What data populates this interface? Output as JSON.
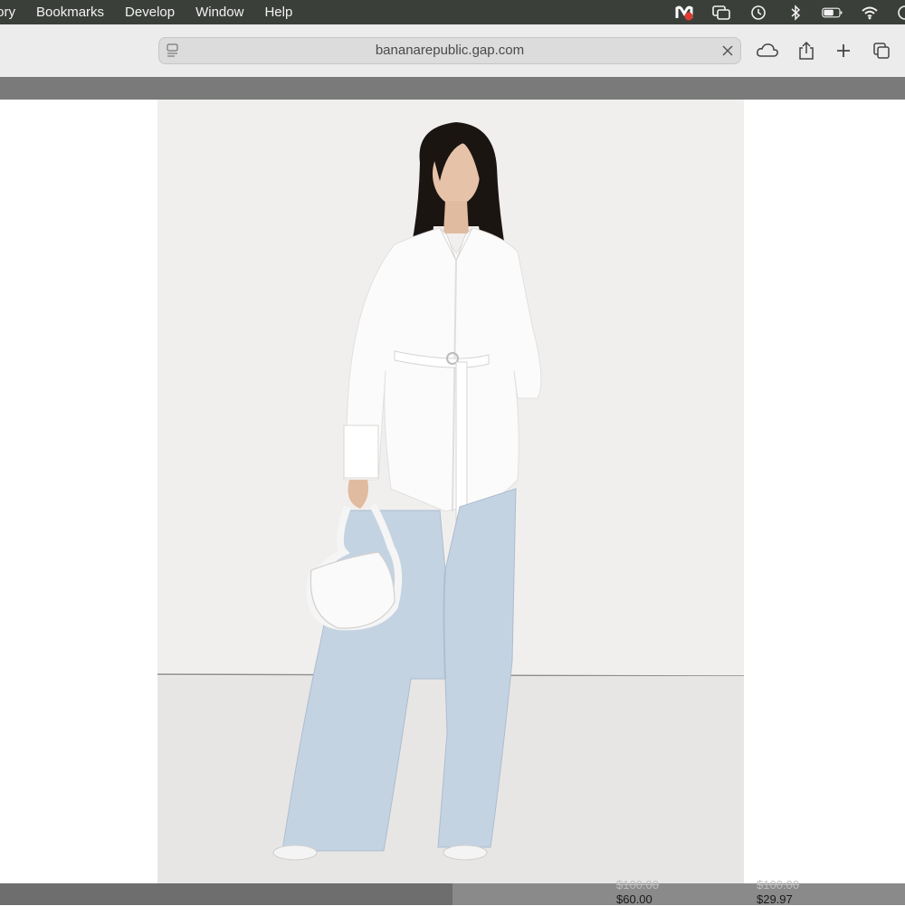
{
  "menubar": {
    "items": [
      "tory",
      "Bookmarks",
      "Develop",
      "Window",
      "Help"
    ],
    "status_icons": [
      "app-status-icon",
      "screen-mirroring-icon",
      "time-machine-icon",
      "bluetooth-icon",
      "battery-icon",
      "wifi-icon"
    ]
  },
  "toolbar": {
    "url": "bananarepublic.gap.com",
    "icons": [
      "reader-icon",
      "clear-icon",
      "icloud-icon",
      "share-icon",
      "new-tab-icon",
      "tab-overview-icon"
    ]
  },
  "product": {
    "image_alt": "Model wearing a belted white shirt and light wash wide-leg jeans, holding a white knotted bag"
  },
  "bottom_products": [
    {
      "old_price": "$100.00",
      "price": "$60.00"
    },
    {
      "old_price": "$100.00",
      "price": "$29.97"
    }
  ],
  "colors": {
    "menubar": "#3b3f3a",
    "toolbar": "#ececec",
    "strip": "#7a7a7a",
    "image_bg": "#f1efee"
  }
}
